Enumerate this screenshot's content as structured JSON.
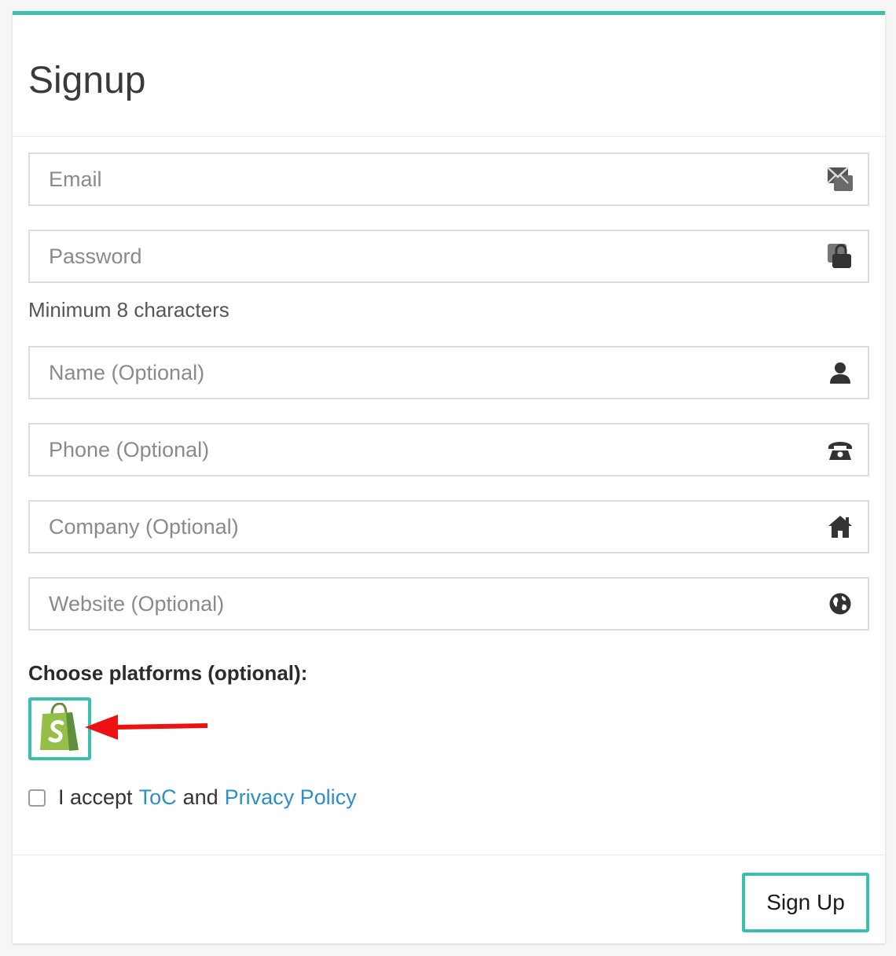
{
  "header": {
    "title": "Signup"
  },
  "fields": {
    "email": {
      "placeholder": "Email",
      "icon": "envelope-icon"
    },
    "password": {
      "placeholder": "Password",
      "icon": "lock-icon"
    },
    "password_hint": "Minimum 8 characters",
    "name": {
      "placeholder": "Name (Optional)",
      "icon": "user-icon"
    },
    "phone": {
      "placeholder": "Phone (Optional)",
      "icon": "phone-icon"
    },
    "company": {
      "placeholder": "Company (Optional)",
      "icon": "home-icon"
    },
    "website": {
      "placeholder": "Website (Optional)",
      "icon": "globe-icon"
    }
  },
  "platforms": {
    "label": "Choose platforms (optional):",
    "items": [
      {
        "icon": "shopify-icon"
      }
    ]
  },
  "terms": {
    "prefix": "I accept",
    "toc_link": "ToC",
    "and": "and",
    "privacy_link": "Privacy Policy",
    "checked": false
  },
  "footer": {
    "signup_label": "Sign Up"
  },
  "colors": {
    "accent": "#3dbfb0",
    "link": "#2a8fc4",
    "arrow": "#ee1111",
    "shopify_green": "#95bf47"
  }
}
